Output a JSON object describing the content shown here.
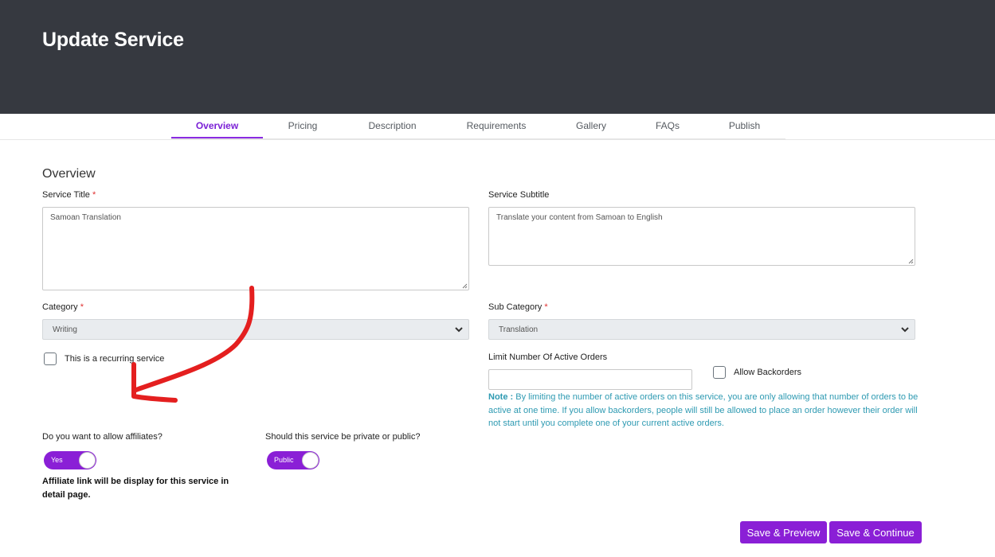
{
  "header": {
    "title": "Update Service"
  },
  "tabs": [
    {
      "label": "Overview",
      "active": true
    },
    {
      "label": "Pricing"
    },
    {
      "label": "Description"
    },
    {
      "label": "Requirements"
    },
    {
      "label": "Gallery"
    },
    {
      "label": "FAQs"
    },
    {
      "label": "Publish"
    }
  ],
  "form": {
    "section_title": "Overview",
    "service_title_label": "Service Title",
    "service_title_value": "Samoan Translation",
    "service_subtitle_label": "Service Subtitle",
    "service_subtitle_value": "Translate your content from Samoan to English",
    "category_label": "Category",
    "category_value": "Writing",
    "sub_category_label": "Sub Category",
    "sub_category_value": "Translation",
    "required_mark": "*",
    "recurring_label": "This is a recurring service",
    "limit_orders_label": "Limit Number Of Active Orders",
    "limit_orders_value": "",
    "allow_backorders_label": "Allow Backorders",
    "note_prefix": "Note :",
    "note_text": "By limiting the number of active orders on this service, you are only allowing that number of orders to be active at one time. If you allow backorders, people will still be allowed to place an order however their order will not start until you complete one of your current active orders.",
    "affiliates_question": "Do you want to allow affiliates?",
    "affiliates_toggle": "Yes",
    "affiliates_note": "Affiliate link will be display for this service in detail page.",
    "privacy_question": "Should this service be private or public?",
    "privacy_toggle": "Public"
  },
  "actions": {
    "save_preview": "Save & Preview",
    "save_continue": "Save & Continue"
  },
  "colors": {
    "header_bg": "#363940",
    "accent": "#8a1fd6",
    "note": "#2e9ab2",
    "annotation": "#e41f1f"
  }
}
